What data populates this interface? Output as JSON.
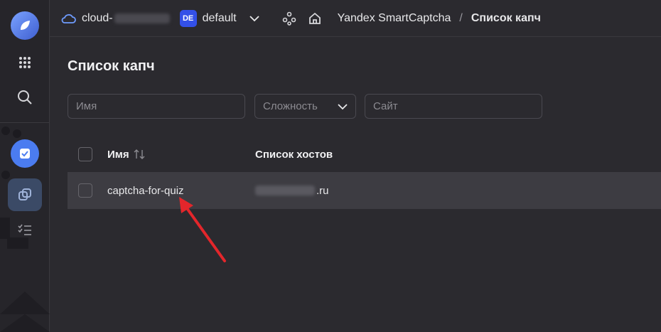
{
  "topbar": {
    "cloud_name": "cloud-",
    "folder_badge": "DE",
    "folder_name": "default",
    "service_name": "Yandex SmartCaptcha",
    "separator": "/",
    "page_name": "Список капч"
  },
  "page": {
    "title": "Список капч"
  },
  "filters": {
    "name_placeholder": "Имя",
    "difficulty_label": "Сложность",
    "site_placeholder": "Сайт"
  },
  "table": {
    "headers": [
      "Имя",
      "Список хостов"
    ],
    "rows": [
      {
        "name": "captcha-for-quiz",
        "host_suffix": ".ru"
      }
    ]
  },
  "colors": {
    "accent": "#4b7cf0",
    "badge": "#3350e8",
    "annotation_arrow": "#e3262b"
  }
}
